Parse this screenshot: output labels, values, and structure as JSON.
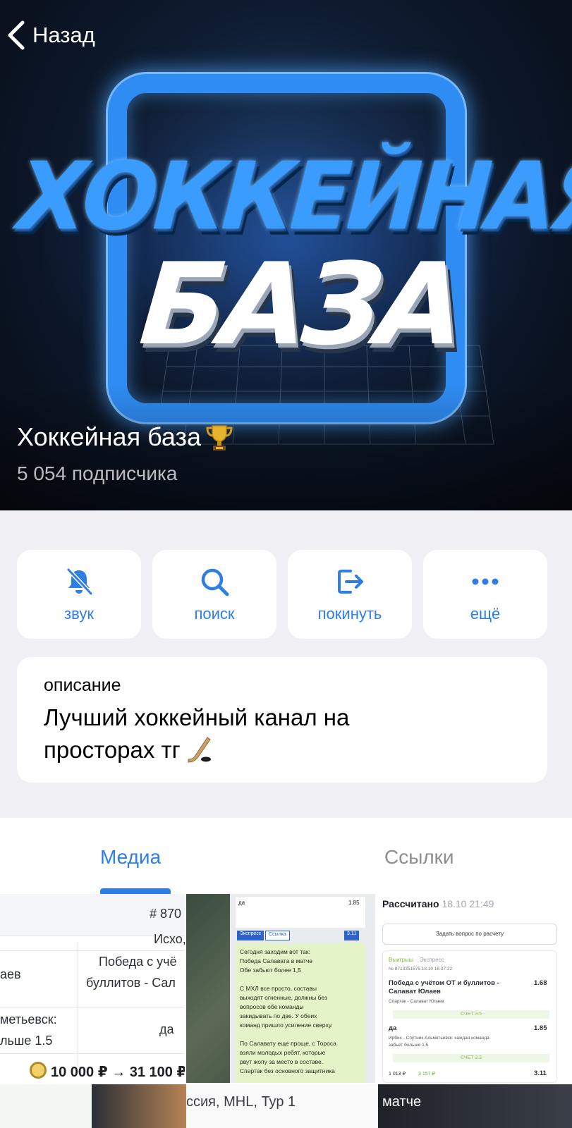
{
  "header": {
    "back_label": "Назад",
    "logo_line1": "ХОККЕЙНАЯ",
    "logo_line2": "БАЗА",
    "channel_title": "Хоккейная база",
    "trophy_icon": "trophy-icon",
    "subscribers": "5 054 подписчика"
  },
  "actions": [
    {
      "label": "звук",
      "icon": "bell-muted-icon"
    },
    {
      "label": "поиск",
      "icon": "search-icon"
    },
    {
      "label": "покинуть",
      "icon": "leave-icon"
    },
    {
      "label": "ещё",
      "icon": "more-icon"
    }
  ],
  "description": {
    "label": "описание",
    "text": "Лучший хоккейный канал на просторах тг",
    "emoji_icon": "hockey-stick-icon"
  },
  "tabs": [
    {
      "label": "Медиа",
      "active": true
    },
    {
      "label": "Ссылки",
      "active": false
    }
  ],
  "accent_color": "#2f7ee6",
  "media": {
    "thumb1": {
      "id": "# 870",
      "outcome_header": "Исхо,",
      "row1_left": "аев",
      "row1_right_1": "Победа с учё",
      "row1_right_2": "буллитов - Сал",
      "row2_left_1": "метьевск:",
      "row2_left_2": "льше 1.5",
      "row2_right": "да",
      "total": "10 000 ₽ → 31 100 ₽"
    },
    "thumb2": {
      "header_title": "да",
      "header_value": "1.85",
      "chip1": "Экспресс",
      "chip2": "Ссылка",
      "value": "3.11",
      "text": "Сегодня заходим вот так:\nПобеда Салавата в матче\nОбе забьют более 1,5\n\nС МХЛ все просто, составы\nвыходят огненные, должны без\nвопросов обе команды\nзакидывать по две. У обеих\nкоманд пришло усиление сверху.\n\nПо Салавату еще проще, с Тороса\nвзяли молодых ребят, которые\nрвут жопу за место в составе.\nСпартак без основного защитника"
    },
    "thumb3": {
      "title": "Рассчитано",
      "time": "18.10 21:49",
      "ask_button": "Задать вопрос по расчету",
      "status_won": "Выигрыш",
      "status_type": "Экспресс",
      "bet_id": "№ 8713351575  18.10  16:37:22",
      "pick1": "Победа с учётом ОТ и буллитов -",
      "pick1_b": "Салават Юлаев",
      "pick1_odds": "1.68",
      "match1": "Спартак - Салават Юлаев",
      "score1": "СЧЕТ 3:5",
      "pick2": "да",
      "pick2_odds": "1.85",
      "pick2_desc": "Ирбис - Спутник Альметьевск: каждая команда",
      "pick2_desc_b": "забьёт больше 1.5",
      "score2": "СЧЕТ 3:3",
      "payout_a": "1 013 ₽",
      "payout_b": "3 157 ₽",
      "payout_odds": "3.11"
    },
    "thumb6_text": "ссия, MHL, Тур 1",
    "thumb7_text": "матче"
  }
}
